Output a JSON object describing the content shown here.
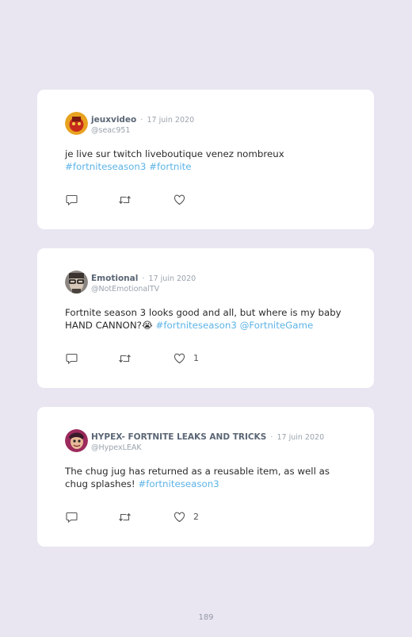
{
  "tweets": [
    {
      "name": "jeuxvideo",
      "separator": "·",
      "date": "17 juin 2020",
      "handle": "@seac951",
      "text_plain": "je live sur twitch liveboutique venez nombreux",
      "hashtags": [
        "#fortniteseason3",
        "#fortnite"
      ],
      "like_count": ""
    },
    {
      "name": "Emotional",
      "separator": "·",
      "date": "17 juin 2020",
      "handle": "@NotEmotionalTV",
      "text_plain": "Fortnite season 3 looks good and all, but where is my baby HAND CANNON?",
      "emoji": "😭",
      "hashtags": [
        "#fortniteseason3",
        "@FortniteGame"
      ],
      "like_count": "1"
    },
    {
      "name": "HYPEX- FORTNITE LEAKS AND TRICKS",
      "separator": "·",
      "date": "17 juin 2020",
      "handle": "@HypexLEAK",
      "text_plain": "The chug jug has returned as a reusable item, as well as chug splashes!",
      "hashtags": [
        "#fortniteseason3"
      ],
      "like_count": "2"
    }
  ],
  "icons": [
    "reply-icon",
    "retweet-icon",
    "heart-icon"
  ],
  "colors": {
    "background": "#e9e6f2",
    "card": "#ffffff",
    "link": "#5cb3e6",
    "name": "#5b6675",
    "muted": "#9aa3ad"
  },
  "page_number": "189"
}
